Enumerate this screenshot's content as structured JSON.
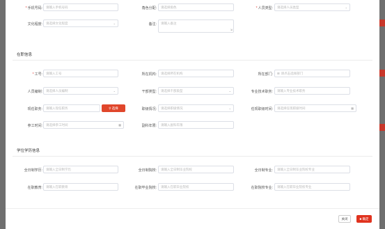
{
  "colors": {
    "primary": "#e0331f",
    "required": "#e0403a",
    "border": "#dcdfe6"
  },
  "top": {
    "phone": {
      "label": "手机号码:",
      "placeholder": "请输入手机号码"
    },
    "role": {
      "label": "角色分配:",
      "placeholder": "请选择角色"
    },
    "person_type": {
      "label": "人员类型:",
      "placeholder": "请选择人员类型"
    },
    "education": {
      "label": "文化程度:",
      "placeholder": "请选择文化程度"
    },
    "remark": {
      "label": "备注:",
      "placeholder": "请输入备注"
    }
  },
  "job": {
    "title": "在职信息",
    "job_no": {
      "label": "工号:",
      "placeholder": "请输入工号"
    },
    "org": {
      "label": "所在机构:",
      "placeholder": "请选择所在机构"
    },
    "dept": {
      "label": "所在部门:",
      "placeholder": "请点击选择部门"
    },
    "staffing": {
      "label": "人员编制:",
      "placeholder": "请选择人员编制"
    },
    "cadre_type": {
      "label": "干部类型:",
      "placeholder": "请选择干部类型"
    },
    "tech_title": {
      "label": "专业技术职务:",
      "placeholder": "请输入专业技术职务"
    },
    "position": {
      "label": "现任职务:",
      "placeholder": "请输入现任职务",
      "button": "选择"
    },
    "rank": {
      "label": "职级情况:",
      "placeholder": "请选择职级情况"
    },
    "rank_time": {
      "label": "任现职级时间:",
      "placeholder": "请选择任现职级时间"
    },
    "work_time": {
      "label": "参工时间:",
      "placeholder": "请选择参工时间"
    },
    "seniority": {
      "label": "副科年限:",
      "placeholder": "请输入副科年限"
    }
  },
  "edu": {
    "title": "学位学历信息",
    "ft_degree": {
      "label": "全日制学历:",
      "placeholder": "请输入全日制学历"
    },
    "ft_school": {
      "label": "全日制院校:",
      "placeholder": "请输入全日制毕业院校"
    },
    "ft_major": {
      "label": "全日制专业:",
      "placeholder": "请输入全日制毕业院校专业"
    },
    "pt_edu": {
      "label": "在职教育:",
      "placeholder": "请输入在职教育"
    },
    "pt_school": {
      "label": "在职毕业院校:",
      "placeholder": "请输入在职毕业院校"
    },
    "pt_major": {
      "label": "在职院校专业:",
      "placeholder": "请输入在职毕业院校专业"
    }
  },
  "footer": {
    "close": "关闭",
    "ok": "确定"
  }
}
